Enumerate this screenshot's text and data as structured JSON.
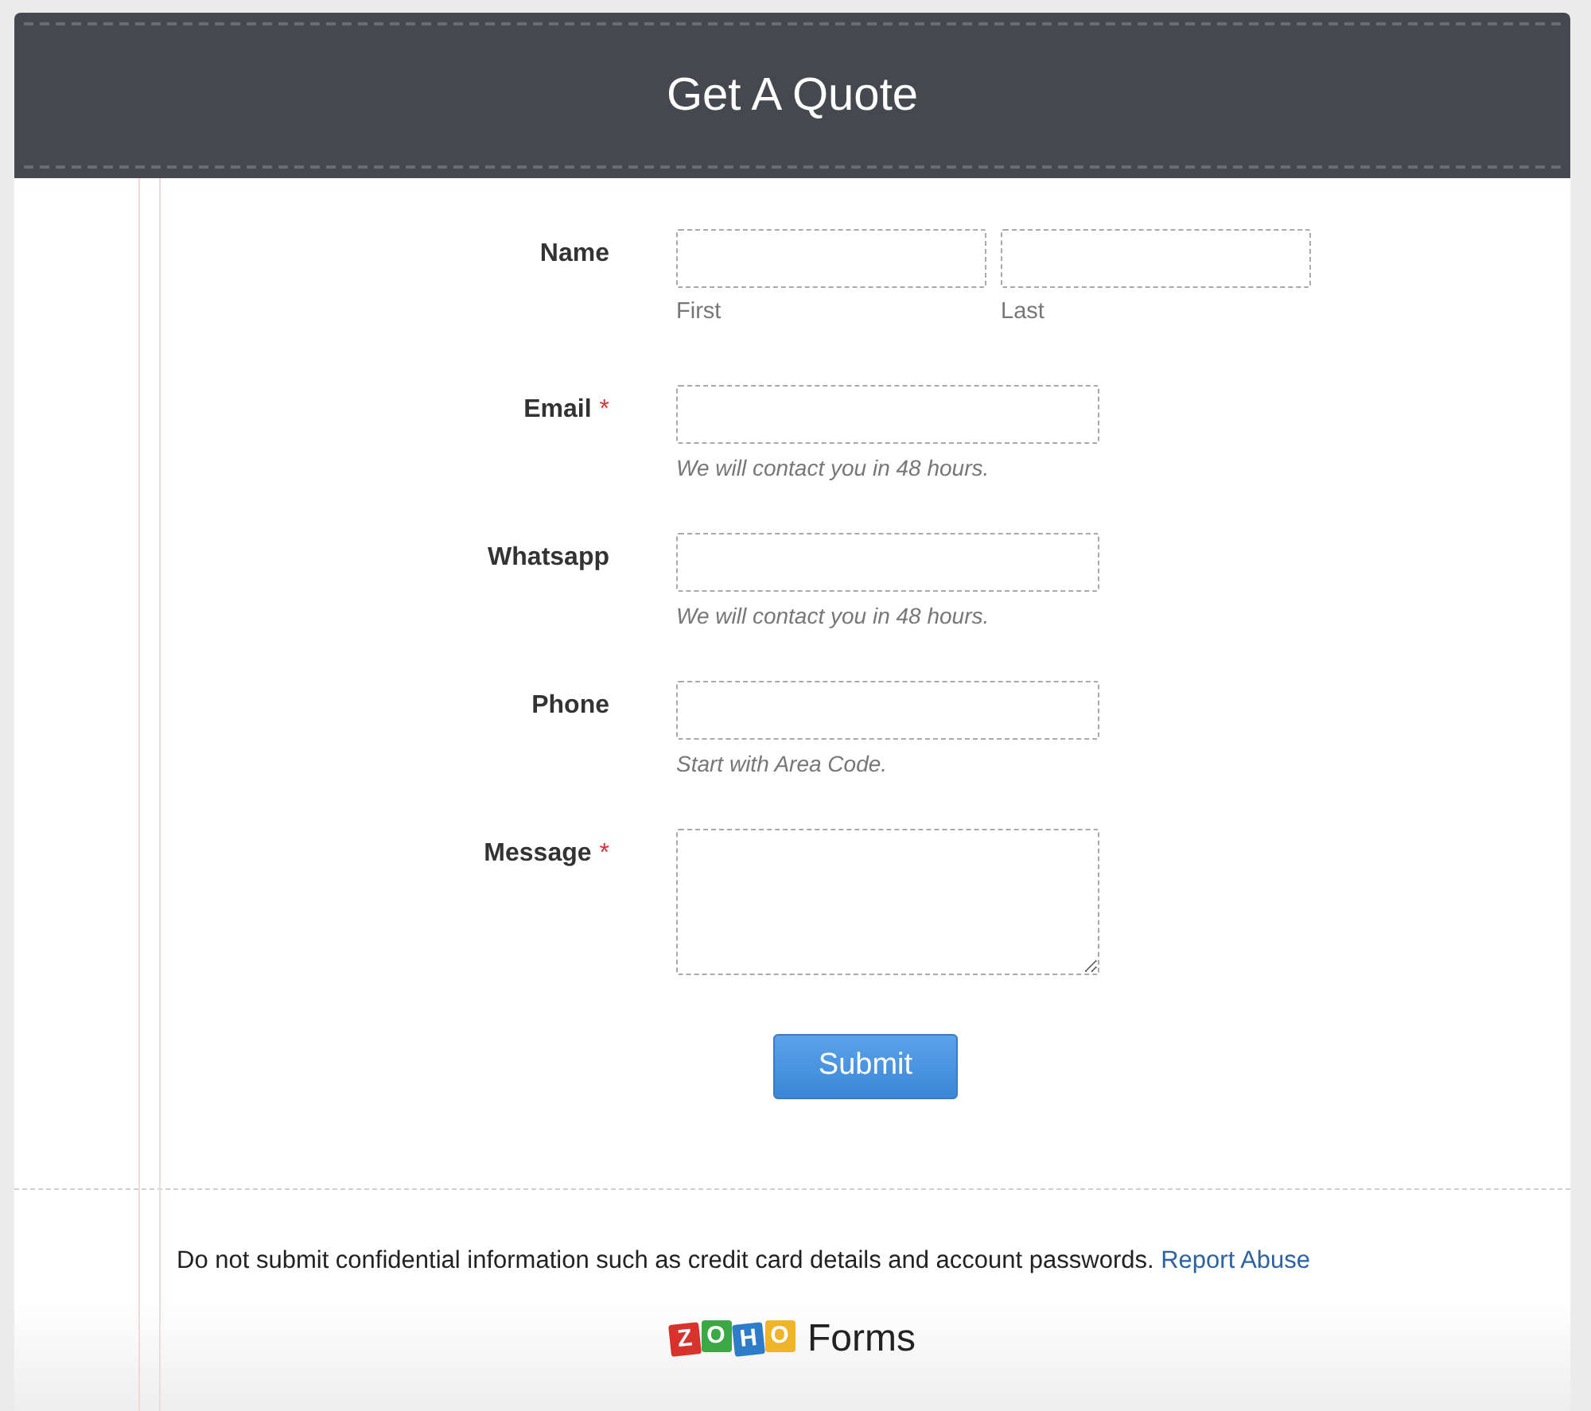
{
  "form_title": "Get A Quote",
  "fields": [
    {
      "kind": "name",
      "label": "Name",
      "parts": [
        {
          "sublabel": "First"
        },
        {
          "sublabel": "Last"
        }
      ]
    },
    {
      "kind": "text",
      "label": "Email",
      "required_mark": "*",
      "hint": "We will contact you in 48 hours."
    },
    {
      "kind": "text",
      "label": "Whatsapp",
      "hint": "We will contact you in 48 hours."
    },
    {
      "kind": "text",
      "label": "Phone",
      "hint": "Start with Area Code."
    },
    {
      "kind": "textarea",
      "label": "Message",
      "required_mark": "*"
    }
  ],
  "submit_button": "Submit",
  "footer": {
    "notice": "Do not submit confidential information such as credit card details and account passwords.",
    "link": "Report Abuse"
  },
  "logo": {
    "tiles": [
      {
        "letter": "Z",
        "color": "#d8322c"
      },
      {
        "letter": "O",
        "color": "#3aa843"
      },
      {
        "letter": "H",
        "color": "#2d7cc8"
      },
      {
        "letter": "O",
        "color": "#f0b428"
      }
    ],
    "product": "Forms"
  }
}
